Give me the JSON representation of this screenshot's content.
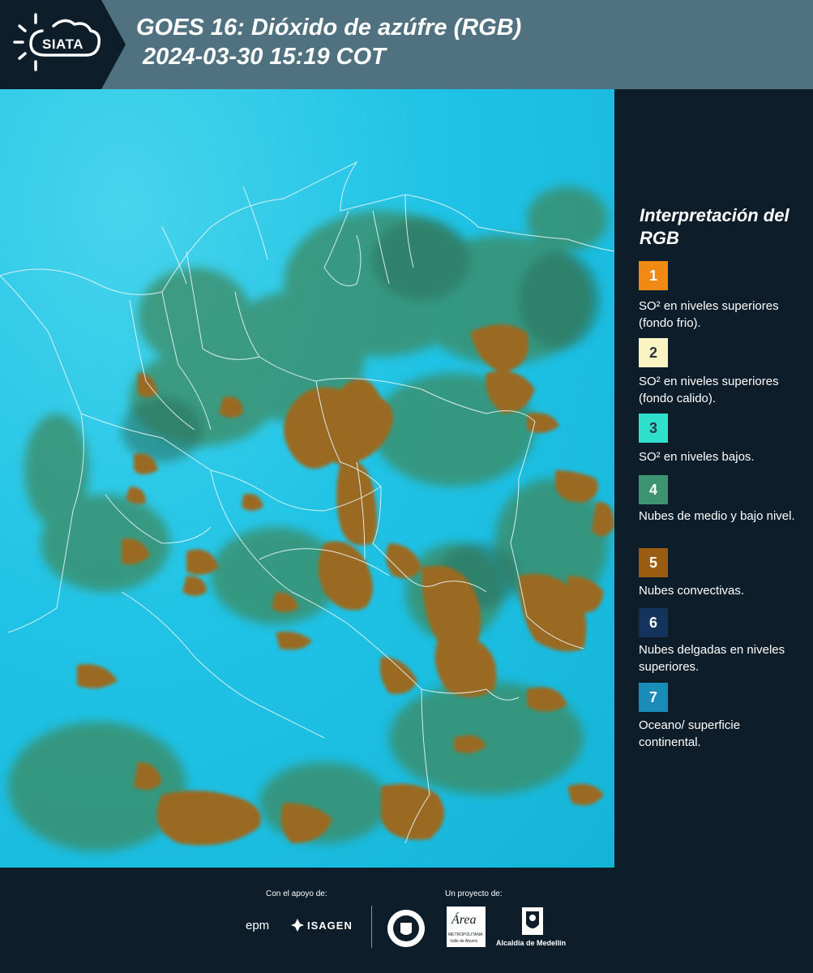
{
  "header": {
    "logo_text": "SIATA",
    "title_line1": "GOES 16: Dióxido de azúfre (RGB)",
    "title_line2": "2024-03-30 15:19 COT"
  },
  "legend": {
    "title": "Interpretación del RGB",
    "items": [
      {
        "number": "1",
        "color": "#f08a12",
        "label": "SO² en niveles superiores (fondo frio)."
      },
      {
        "number": "2",
        "color": "#fbf4c2",
        "label": "SO² en niveles superiores (fondo calido)."
      },
      {
        "number": "3",
        "color": "#2fe0cc",
        "label": "SO² en niveles bajos."
      },
      {
        "number": "4",
        "color": "#3e9472",
        "label": "Nubes de medio y bajo nivel."
      },
      {
        "number": "5",
        "color": "#9a5c10",
        "label": "Nubes convectivas."
      },
      {
        "number": "6",
        "color": "#14345e",
        "label": "Nubes delgadas en niveles superiores."
      },
      {
        "number": "7",
        "color": "#1a8cb8",
        "label": "Oceano/ superficie continental."
      }
    ]
  },
  "footer": {
    "support_label": "Con el apoyo de:",
    "project_label": "Un proyecto de:",
    "sponsor_epm": "epm",
    "sponsor_isagen": "ISAGEN",
    "area_logo_text": "Área",
    "area_logo_sub": "METROPOLITANA",
    "area_logo_sub2": "Valle de Aburrá",
    "alcaldia": "Alcaldía de Medellín"
  },
  "colors": {
    "ocean": "#1ec0e5",
    "convective": "#9a6a24",
    "mid_low_cloud": "#3f8a62",
    "header_bg": "#4f7180",
    "panel_bg": "#0d1d2a"
  }
}
